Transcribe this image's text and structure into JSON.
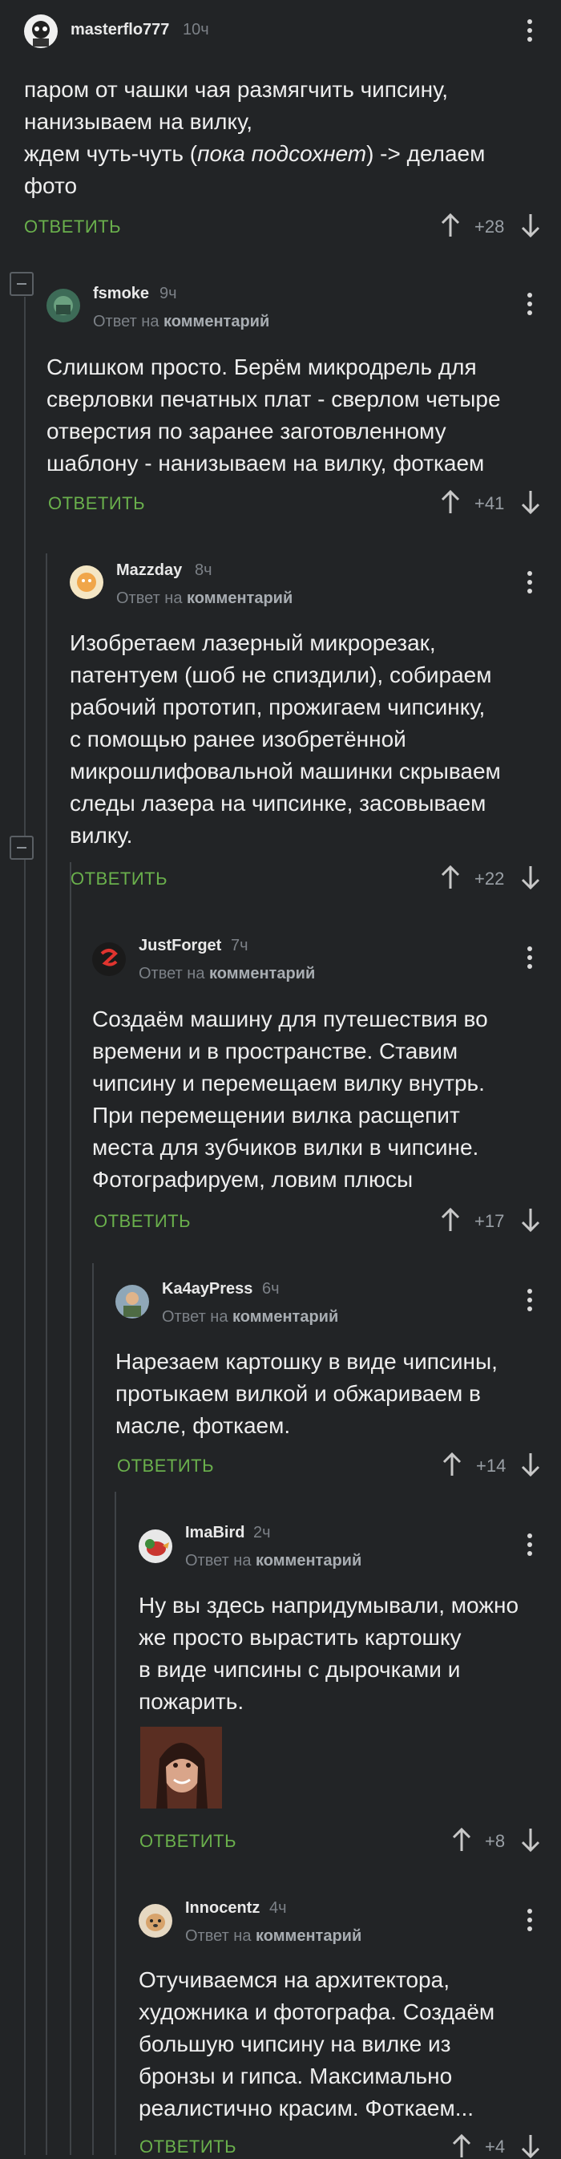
{
  "comments": [
    {
      "username": "masterflo777",
      "time": "10ч",
      "reply_prefix": "",
      "reply_target": "",
      "lines": [
        "паром от чашки чая размягчить чипсину,",
        "нанизываем на вилку,",
        "ждем чуть-чуть (пока подсохнет) -> делаем",
        "фото"
      ],
      "answer": "ОТВЕТИТЬ",
      "score": "+28"
    },
    {
      "username": "fsmoke",
      "time": "9ч",
      "reply_prefix": "Ответ на",
      "reply_target": "комментарий",
      "lines": [
        "Слишком просто. Берём микродрель для",
        "сверловки печатных плат - сверлом четыре",
        "отверстия по заранее заготовленному",
        "шаблону - нанизываем на вилку, фоткаем"
      ],
      "answer": "ОТВЕТИТЬ",
      "score": "+41"
    },
    {
      "username": "Mazzday",
      "time": "8ч",
      "reply_prefix": "Ответ на",
      "reply_target": "комментарий",
      "lines": [
        "Изобретаем лазерный микрорезак,",
        "патентуем (шоб не спиздили), собираем",
        "рабочий прототип, прожигаем чипсинку,",
        "с помощью ранее изобретённой",
        "микрошлифовальной машинки скрываем",
        "следы лазера на чипсинке, засовываем",
        "вилку."
      ],
      "answer": "ОТВЕТИТЬ",
      "score": "+22"
    },
    {
      "username": "JustForget",
      "time": "7ч",
      "reply_prefix": "Ответ на",
      "reply_target": "комментарий",
      "lines": [
        "Создаём машину для путешествия во",
        "времени и в пространстве. Ставим",
        "чипсину и перемещаем вилку внутрь.",
        "При перемещении вилка расщепит",
        "места для зубчиков вилки в чипсине.",
        "Фотографируем, ловим плюсы"
      ],
      "answer": "ОТВЕТИТЬ",
      "score": "+17"
    },
    {
      "username": "Ka4ayPress",
      "time": "6ч",
      "reply_prefix": "Ответ на",
      "reply_target": "комментарий",
      "lines": [
        "Нарезаем картошку в виде чипсины,",
        "протыкаем вилкой и обжариваем в",
        "масле, фоткаем."
      ],
      "answer": "ОТВЕТИТЬ",
      "score": "+14"
    },
    {
      "username": "ImaBird",
      "time": "2ч",
      "reply_prefix": "Ответ на",
      "reply_target": "комментарий",
      "lines": [
        "Ну вы здесь напридумывали, можно",
        "же просто вырастить картошку",
        "в виде чипсины с дырочками и",
        "пожарить."
      ],
      "answer": "ОТВЕТИТЬ",
      "score": "+8"
    },
    {
      "username": "Innocentz",
      "time": "4ч",
      "reply_prefix": "Ответ на",
      "reply_target": "комментарий",
      "lines": [
        "Отучиваемся на архитектора,",
        "художника и фотографа. Создаём",
        "большую чипсину на вилке из",
        "бронзы и гипса. Максимально",
        "реалистично красим. Фоткаем..."
      ],
      "answer": "ОТВЕТИТЬ",
      "score": "+4"
    }
  ],
  "comment0_italic": "пока подсохнет",
  "colors": {
    "background": "#222426",
    "accent": "#6ab04c",
    "text": "#e9e9e9",
    "muted": "#7c8187",
    "thread": "#3f4347"
  }
}
